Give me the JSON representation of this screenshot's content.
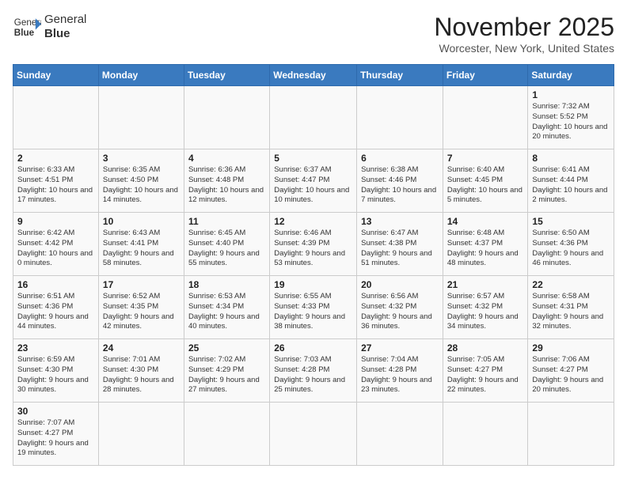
{
  "logo": {
    "line1": "General",
    "line2": "Blue"
  },
  "title": "November 2025",
  "subtitle": "Worcester, New York, United States",
  "days_of_week": [
    "Sunday",
    "Monday",
    "Tuesday",
    "Wednesday",
    "Thursday",
    "Friday",
    "Saturday"
  ],
  "weeks": [
    [
      {
        "day": "",
        "info": ""
      },
      {
        "day": "",
        "info": ""
      },
      {
        "day": "",
        "info": ""
      },
      {
        "day": "",
        "info": ""
      },
      {
        "day": "",
        "info": ""
      },
      {
        "day": "",
        "info": ""
      },
      {
        "day": "1",
        "info": "Sunrise: 7:32 AM\nSunset: 5:52 PM\nDaylight: 10 hours and 20 minutes."
      }
    ],
    [
      {
        "day": "2",
        "info": "Sunrise: 6:33 AM\nSunset: 4:51 PM\nDaylight: 10 hours and 17 minutes."
      },
      {
        "day": "3",
        "info": "Sunrise: 6:35 AM\nSunset: 4:50 PM\nDaylight: 10 hours and 14 minutes."
      },
      {
        "day": "4",
        "info": "Sunrise: 6:36 AM\nSunset: 4:48 PM\nDaylight: 10 hours and 12 minutes."
      },
      {
        "day": "5",
        "info": "Sunrise: 6:37 AM\nSunset: 4:47 PM\nDaylight: 10 hours and 10 minutes."
      },
      {
        "day": "6",
        "info": "Sunrise: 6:38 AM\nSunset: 4:46 PM\nDaylight: 10 hours and 7 minutes."
      },
      {
        "day": "7",
        "info": "Sunrise: 6:40 AM\nSunset: 4:45 PM\nDaylight: 10 hours and 5 minutes."
      },
      {
        "day": "8",
        "info": "Sunrise: 6:41 AM\nSunset: 4:44 PM\nDaylight: 10 hours and 2 minutes."
      }
    ],
    [
      {
        "day": "9",
        "info": "Sunrise: 6:42 AM\nSunset: 4:42 PM\nDaylight: 10 hours and 0 minutes."
      },
      {
        "day": "10",
        "info": "Sunrise: 6:43 AM\nSunset: 4:41 PM\nDaylight: 9 hours and 58 minutes."
      },
      {
        "day": "11",
        "info": "Sunrise: 6:45 AM\nSunset: 4:40 PM\nDaylight: 9 hours and 55 minutes."
      },
      {
        "day": "12",
        "info": "Sunrise: 6:46 AM\nSunset: 4:39 PM\nDaylight: 9 hours and 53 minutes."
      },
      {
        "day": "13",
        "info": "Sunrise: 6:47 AM\nSunset: 4:38 PM\nDaylight: 9 hours and 51 minutes."
      },
      {
        "day": "14",
        "info": "Sunrise: 6:48 AM\nSunset: 4:37 PM\nDaylight: 9 hours and 48 minutes."
      },
      {
        "day": "15",
        "info": "Sunrise: 6:50 AM\nSunset: 4:36 PM\nDaylight: 9 hours and 46 minutes."
      }
    ],
    [
      {
        "day": "16",
        "info": "Sunrise: 6:51 AM\nSunset: 4:36 PM\nDaylight: 9 hours and 44 minutes."
      },
      {
        "day": "17",
        "info": "Sunrise: 6:52 AM\nSunset: 4:35 PM\nDaylight: 9 hours and 42 minutes."
      },
      {
        "day": "18",
        "info": "Sunrise: 6:53 AM\nSunset: 4:34 PM\nDaylight: 9 hours and 40 minutes."
      },
      {
        "day": "19",
        "info": "Sunrise: 6:55 AM\nSunset: 4:33 PM\nDaylight: 9 hours and 38 minutes."
      },
      {
        "day": "20",
        "info": "Sunrise: 6:56 AM\nSunset: 4:32 PM\nDaylight: 9 hours and 36 minutes."
      },
      {
        "day": "21",
        "info": "Sunrise: 6:57 AM\nSunset: 4:32 PM\nDaylight: 9 hours and 34 minutes."
      },
      {
        "day": "22",
        "info": "Sunrise: 6:58 AM\nSunset: 4:31 PM\nDaylight: 9 hours and 32 minutes."
      }
    ],
    [
      {
        "day": "23",
        "info": "Sunrise: 6:59 AM\nSunset: 4:30 PM\nDaylight: 9 hours and 30 minutes."
      },
      {
        "day": "24",
        "info": "Sunrise: 7:01 AM\nSunset: 4:30 PM\nDaylight: 9 hours and 28 minutes."
      },
      {
        "day": "25",
        "info": "Sunrise: 7:02 AM\nSunset: 4:29 PM\nDaylight: 9 hours and 27 minutes."
      },
      {
        "day": "26",
        "info": "Sunrise: 7:03 AM\nSunset: 4:28 PM\nDaylight: 9 hours and 25 minutes."
      },
      {
        "day": "27",
        "info": "Sunrise: 7:04 AM\nSunset: 4:28 PM\nDaylight: 9 hours and 23 minutes."
      },
      {
        "day": "28",
        "info": "Sunrise: 7:05 AM\nSunset: 4:27 PM\nDaylight: 9 hours and 22 minutes."
      },
      {
        "day": "29",
        "info": "Sunrise: 7:06 AM\nSunset: 4:27 PM\nDaylight: 9 hours and 20 minutes."
      }
    ],
    [
      {
        "day": "30",
        "info": "Sunrise: 7:07 AM\nSunset: 4:27 PM\nDaylight: 9 hours and 19 minutes."
      },
      {
        "day": "",
        "info": ""
      },
      {
        "day": "",
        "info": ""
      },
      {
        "day": "",
        "info": ""
      },
      {
        "day": "",
        "info": ""
      },
      {
        "day": "",
        "info": ""
      },
      {
        "day": "",
        "info": ""
      }
    ]
  ]
}
